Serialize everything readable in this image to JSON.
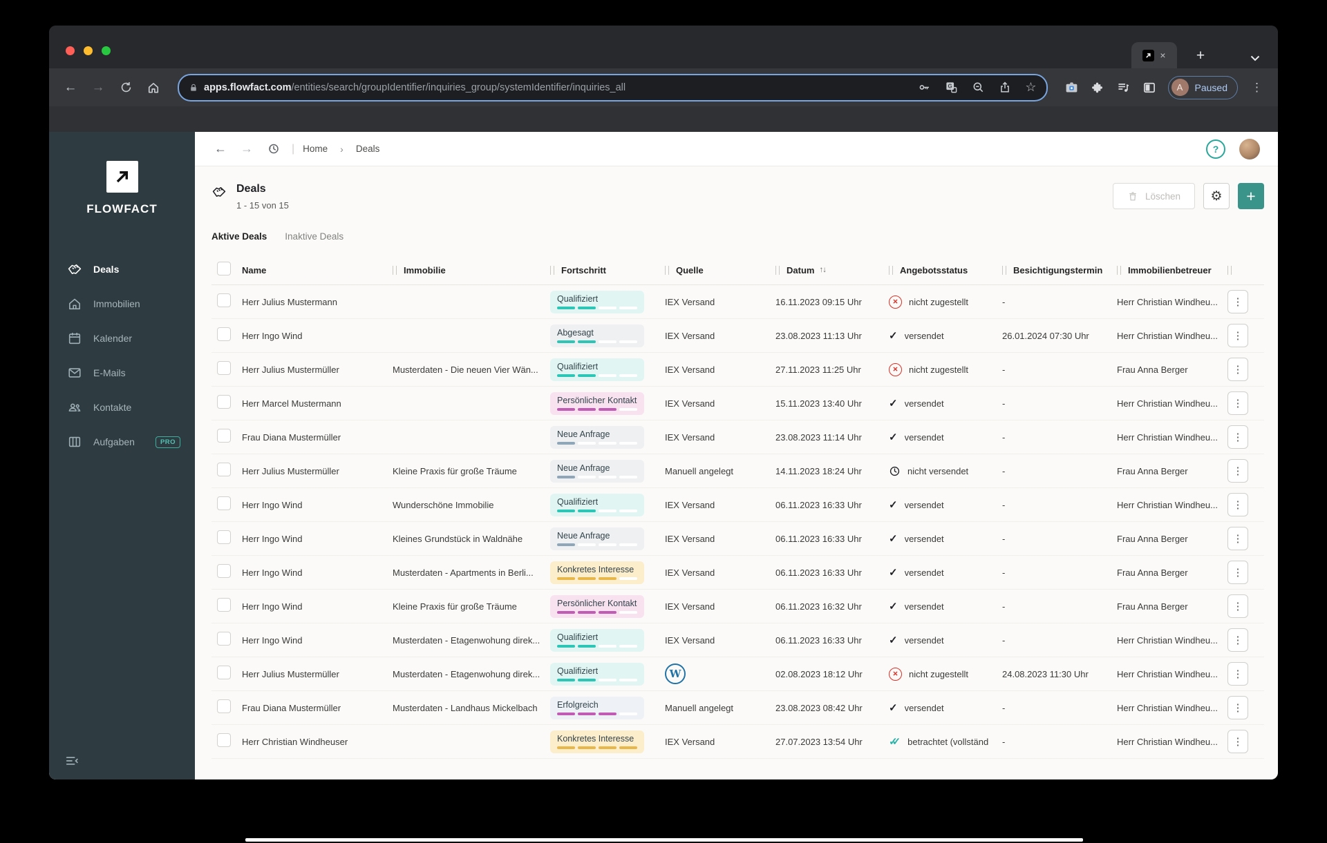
{
  "colors": {
    "accent_teal": "#3b948a",
    "sidebar_bg": "#2e3b41",
    "status_error_red": "#d93025",
    "status_double_teal": "#2bb3a8",
    "wordpress_blue": "#2173a6",
    "chip_bg": {
      "teal": "#e1f6f3",
      "grey": "#eef0f1",
      "pink": "#f8e2ef",
      "yellow": "#fcedcb",
      "slate": "#eef2f6"
    },
    "chip_bar": {
      "teal": "#2ec5b6",
      "purple": "#c05cb4",
      "bluegrey": "#8fa6b8",
      "yellow": "#e8b74b",
      "empty": "#ffffff"
    }
  },
  "browser": {
    "tab": {
      "close_icon": "×",
      "new_tab_icon": "+"
    },
    "url": {
      "host": "apps.flowfact.com",
      "path": "/entities/search/groupIdentifier/inquiries_group/systemIdentifier/inquiries_all"
    },
    "profile": {
      "initial": "A",
      "label": "Paused"
    },
    "glyphs": {
      "back": "←",
      "forward": "→",
      "star": "☆",
      "kebab": "⋮"
    }
  },
  "sidebar": {
    "brand": "FLOWFACT",
    "items": [
      {
        "label": "Deals",
        "active": true
      },
      {
        "label": "Immobilien"
      },
      {
        "label": "Kalender"
      },
      {
        "label": "E-Mails"
      },
      {
        "label": "Kontakte"
      },
      {
        "label": "Aufgaben",
        "badge": "PRO"
      }
    ]
  },
  "breadcrumb": {
    "home": "Home",
    "current": "Deals",
    "chevron": "›",
    "divider": "|"
  },
  "page": {
    "title": "Deals",
    "count": "1 - 15 von 15",
    "delete_label": "Löschen",
    "gear_icon": "⚙",
    "plus_icon": "+",
    "help_icon": "?",
    "tabs": [
      {
        "label": "Aktive Deals",
        "active": true
      },
      {
        "label": "Inaktive Deals",
        "active": false
      }
    ]
  },
  "table": {
    "columns": [
      "Name",
      "Immobilie",
      "Fortschritt",
      "Quelle",
      "Datum",
      "Angebotsstatus",
      "Besichtigungstermin",
      "Immobilienbetreuer"
    ],
    "sort_icon": "↑↓",
    "rows": [
      {
        "name": "Herr Julius Mustermann",
        "immobilie": "",
        "progress": {
          "label": "Qualifiziert",
          "bg": "teal",
          "bar": "teal",
          "filled": 2,
          "total": 4
        },
        "quelle": {
          "type": "text",
          "label": "IEX Versand"
        },
        "datum": "16.11.2023 09:15 Uhr",
        "status": {
          "type": "error",
          "label": "nicht zugestellt"
        },
        "termin": "-",
        "betreuer": "Herr Christian Windheu..."
      },
      {
        "name": "Herr Ingo Wind",
        "immobilie": "",
        "progress": {
          "label": "Abgesagt",
          "bg": "grey",
          "bar": "teal",
          "filled": 2,
          "total": 4
        },
        "quelle": {
          "type": "text",
          "label": "IEX Versand"
        },
        "datum": "23.08.2023 11:13 Uhr",
        "status": {
          "type": "check",
          "label": "versendet"
        },
        "termin": "26.01.2024 07:30 Uhr",
        "betreuer": "Herr Christian Windheu..."
      },
      {
        "name": "Herr Julius Mustermüller",
        "immobilie": "Musterdaten - Die neuen Vier Wän...",
        "progress": {
          "label": "Qualifiziert",
          "bg": "teal",
          "bar": "teal",
          "filled": 2,
          "total": 4
        },
        "quelle": {
          "type": "text",
          "label": "IEX Versand"
        },
        "datum": "27.11.2023 11:25 Uhr",
        "status": {
          "type": "error",
          "label": "nicht zugestellt"
        },
        "termin": "-",
        "betreuer": "Frau Anna Berger"
      },
      {
        "name": "Herr Marcel Mustermann",
        "immobilie": "",
        "progress": {
          "label": "Persönlicher Kontakt",
          "bg": "pink",
          "bar": "purple",
          "filled": 3,
          "total": 4
        },
        "quelle": {
          "type": "text",
          "label": "IEX Versand"
        },
        "datum": "15.11.2023 13:40 Uhr",
        "status": {
          "type": "check",
          "label": "versendet"
        },
        "termin": "-",
        "betreuer": "Herr Christian Windheu..."
      },
      {
        "name": "Frau Diana Mustermüller",
        "immobilie": "",
        "progress": {
          "label": "Neue Anfrage",
          "bg": "grey",
          "bar": "bluegrey",
          "filled": 1,
          "total": 4
        },
        "quelle": {
          "type": "text",
          "label": "IEX Versand"
        },
        "datum": "23.08.2023 11:14 Uhr",
        "status": {
          "type": "check",
          "label": "versendet"
        },
        "termin": "-",
        "betreuer": "Herr Christian Windheu..."
      },
      {
        "name": "Herr Julius Mustermüller",
        "immobilie": "Kleine Praxis für große Träume",
        "progress": {
          "label": "Neue Anfrage",
          "bg": "grey",
          "bar": "bluegrey",
          "filled": 1,
          "total": 4
        },
        "quelle": {
          "type": "text",
          "label": "Manuell angelegt"
        },
        "datum": "14.11.2023 18:24 Uhr",
        "status": {
          "type": "clock",
          "label": "nicht versendet"
        },
        "termin": "-",
        "betreuer": "Frau Anna Berger"
      },
      {
        "name": "Herr Ingo Wind",
        "immobilie": "Wunderschöne Immobilie",
        "progress": {
          "label": "Qualifiziert",
          "bg": "teal",
          "bar": "teal",
          "filled": 2,
          "total": 4
        },
        "quelle": {
          "type": "text",
          "label": "IEX Versand"
        },
        "datum": "06.11.2023 16:33 Uhr",
        "status": {
          "type": "check",
          "label": "versendet"
        },
        "termin": "-",
        "betreuer": "Herr Christian Windheu..."
      },
      {
        "name": "Herr Ingo Wind",
        "immobilie": "Kleines Grundstück in Waldnähe",
        "progress": {
          "label": "Neue Anfrage",
          "bg": "grey",
          "bar": "bluegrey",
          "filled": 1,
          "total": 4
        },
        "quelle": {
          "type": "text",
          "label": "IEX Versand"
        },
        "datum": "06.11.2023 16:33 Uhr",
        "status": {
          "type": "check",
          "label": "versendet"
        },
        "termin": "-",
        "betreuer": "Frau Anna Berger"
      },
      {
        "name": "Herr Ingo Wind",
        "immobilie": "Musterdaten - Apartments in Berli...",
        "progress": {
          "label": "Konkretes Interesse",
          "bg": "yellow",
          "bar": "yellow",
          "filled": 3,
          "total": 4
        },
        "quelle": {
          "type": "text",
          "label": "IEX Versand"
        },
        "datum": "06.11.2023 16:33 Uhr",
        "status": {
          "type": "check",
          "label": "versendet"
        },
        "termin": "-",
        "betreuer": "Frau Anna Berger"
      },
      {
        "name": "Herr Ingo Wind",
        "immobilie": "Kleine Praxis für große Träume",
        "progress": {
          "label": "Persönlicher Kontakt",
          "bg": "pink",
          "bar": "purple",
          "filled": 3,
          "total": 4
        },
        "quelle": {
          "type": "text",
          "label": "IEX Versand"
        },
        "datum": "06.11.2023 16:32 Uhr",
        "status": {
          "type": "check",
          "label": "versendet"
        },
        "termin": "-",
        "betreuer": "Frau Anna Berger"
      },
      {
        "name": "Herr Ingo Wind",
        "immobilie": "Musterdaten - Etagenwohung direk...",
        "progress": {
          "label": "Qualifiziert",
          "bg": "teal",
          "bar": "teal",
          "filled": 2,
          "total": 4
        },
        "quelle": {
          "type": "text",
          "label": "IEX Versand"
        },
        "datum": "06.11.2023 16:33 Uhr",
        "status": {
          "type": "check",
          "label": "versendet"
        },
        "termin": "-",
        "betreuer": "Herr Christian Windheu..."
      },
      {
        "name": "Herr Julius Mustermüller",
        "immobilie": "Musterdaten - Etagenwohung direk...",
        "progress": {
          "label": "Qualifiziert",
          "bg": "teal",
          "bar": "teal",
          "filled": 2,
          "total": 4
        },
        "quelle": {
          "type": "wordpress",
          "label": ""
        },
        "datum": "02.08.2023 18:12 Uhr",
        "status": {
          "type": "error",
          "label": "nicht zugestellt"
        },
        "termin": "24.08.2023 11:30 Uhr",
        "betreuer": "Herr Christian Windheu..."
      },
      {
        "name": "Frau Diana Mustermüller",
        "immobilie": "Musterdaten - Landhaus Mickelbach",
        "progress": {
          "label": "Erfolgreich",
          "bg": "slate",
          "bar": "purple",
          "filled": 3,
          "total": 4
        },
        "quelle": {
          "type": "text",
          "label": "Manuell angelegt"
        },
        "datum": "23.08.2023 08:42 Uhr",
        "status": {
          "type": "check",
          "label": "versendet"
        },
        "termin": "-",
        "betreuer": "Herr Christian Windheu..."
      },
      {
        "name": "Herr Christian Windheuser",
        "immobilie": "",
        "progress": {
          "label": "Konkretes Interesse",
          "bg": "yellow",
          "bar": "yellow",
          "filled": 4,
          "total": 4
        },
        "quelle": {
          "type": "text",
          "label": "IEX Versand"
        },
        "datum": "27.07.2023 13:54 Uhr",
        "status": {
          "type": "double",
          "label": "betrachtet (vollständ"
        },
        "termin": "-",
        "betreuer": "Herr Christian Windheu..."
      }
    ]
  }
}
